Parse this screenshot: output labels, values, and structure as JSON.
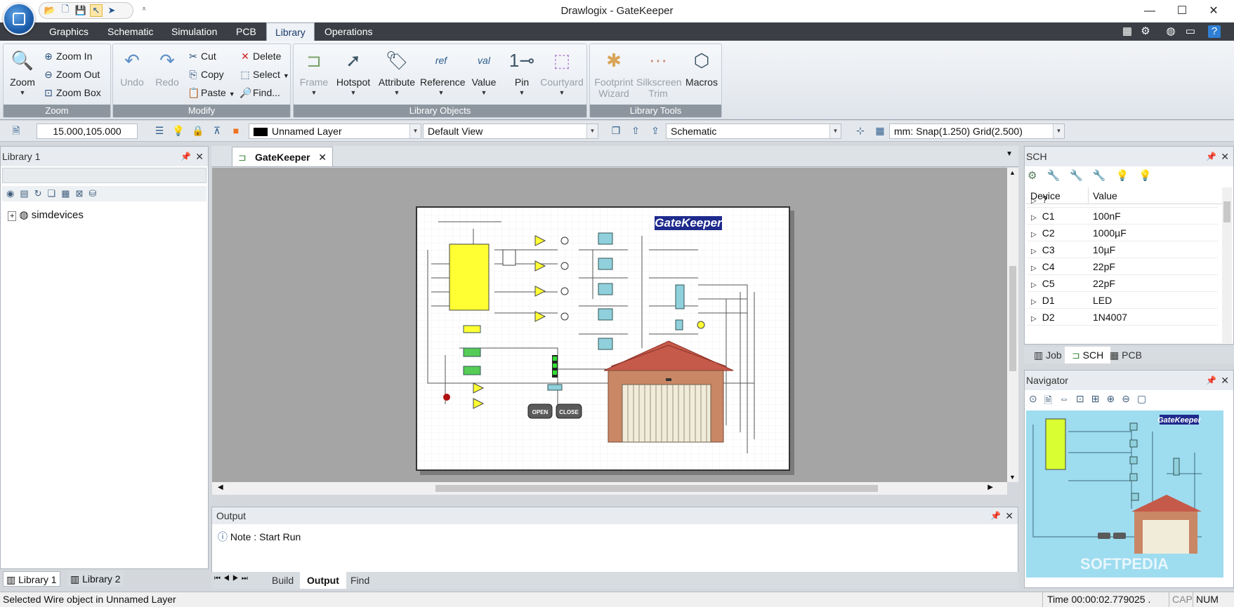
{
  "window": {
    "title": "Drawlogix - GateKeeper"
  },
  "ribbon_tabs": [
    "Graphics",
    "Schematic",
    "Simulation",
    "PCB",
    "Library",
    "Operations"
  ],
  "ribbon": {
    "zoom": {
      "zoom": "Zoom",
      "zoom_in": "Zoom In",
      "zoom_out": "Zoom Out",
      "zoom_box": "Zoom Box",
      "group": "Zoom"
    },
    "modify": {
      "undo": "Undo",
      "redo": "Redo",
      "cut": "Cut",
      "copy": "Copy",
      "paste": "Paste",
      "delete": "Delete",
      "select": "Select",
      "find": "Find...",
      "group": "Modify"
    },
    "library_objects": {
      "frame": "Frame",
      "hotspot": "Hotspot",
      "attribute": "Attribute",
      "reference": "Reference",
      "value": "Value",
      "pin": "Pin",
      "courtyard": "Courtyard",
      "group": "Library Objects"
    },
    "library_tools": {
      "footprint_wizard_1": "Footprint",
      "footprint_wizard_2": "Wizard",
      "silkscreen_trim_1": "Silkscreen",
      "silkscreen_trim_2": "Trim",
      "macros": "Macros",
      "group": "Library Tools"
    }
  },
  "toolbar": {
    "coords": "15.000,105.000",
    "layer": "Unnamed Layer",
    "view": "Default View",
    "mode": "Schematic",
    "snap": "mm: Snap(1.250) Grid(2.500)"
  },
  "library_panel": {
    "title": "Library 1",
    "tree_root": "simdevices",
    "tabs": [
      "Library 1",
      "Library 2"
    ]
  },
  "document": {
    "tab": "GateKeeper",
    "sheet_title": "GateKeeper",
    "open_button": "OPEN",
    "close_button": "CLOSE"
  },
  "output_panel": {
    "title": "Output",
    "note": "Note : Start Run",
    "tabs": [
      "Build",
      "Output",
      "Find"
    ]
  },
  "sch_panel": {
    "title": "SCH",
    "headers": [
      "Device",
      "Value"
    ],
    "rows": [
      {
        "device": "?",
        "value": ""
      },
      {
        "device": "C1",
        "value": "100nF"
      },
      {
        "device": "C2",
        "value": "1000µF"
      },
      {
        "device": "C3",
        "value": "10µF"
      },
      {
        "device": "C4",
        "value": "22pF"
      },
      {
        "device": "C5",
        "value": "22pF"
      },
      {
        "device": "D1",
        "value": "LED"
      },
      {
        "device": "D2",
        "value": "1N4007"
      }
    ],
    "tabs": [
      "Job",
      "SCH",
      "PCB"
    ]
  },
  "navigator": {
    "title": "Navigator",
    "watermark": "SOFTPEDIA"
  },
  "status_bar": {
    "message": "Selected Wire object in Unnamed Layer",
    "time": "Time  00:00:02.779025 .",
    "cap": "CAP",
    "num": "NUM"
  },
  "colors": {
    "accent": "#1d5fae",
    "tabbar": "#3b3f45",
    "canvas": "#a5a5a5",
    "ic_yellow": "#ffff33",
    "relay": "#8fd0dc"
  }
}
